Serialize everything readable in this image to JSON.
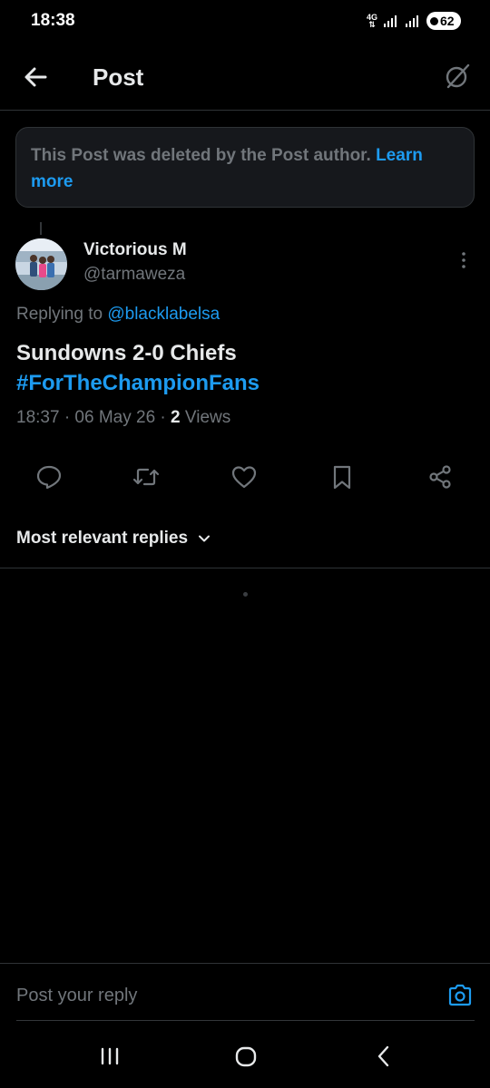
{
  "status_bar": {
    "time": "18:38",
    "network": "4G",
    "battery": "62"
  },
  "header": {
    "title": "Post",
    "back_icon": "arrow-left-icon",
    "grok_icon": "grok-icon"
  },
  "deleted_notice": {
    "text": "This Post was deleted by the Post author. ",
    "link": "Learn more"
  },
  "post": {
    "display_name": "Victorious M",
    "handle": "@tarmaweza",
    "replying_prefix": "Replying to ",
    "replying_to": "@blacklabelsa",
    "text_line1": "Sundowns 2-0 Chiefs",
    "hashtag": "#ForTheChampionFans",
    "timestamp": "18:37 · 06 May 26 · ",
    "views_count": "2",
    "views_label": " Views"
  },
  "actions": [
    "reply-icon",
    "repost-icon",
    "like-icon",
    "bookmark-icon",
    "share-icon"
  ],
  "replies": {
    "sort_label": "Most relevant replies"
  },
  "composer": {
    "placeholder": "Post your reply"
  },
  "colors": {
    "accent": "#1d9bf0",
    "background": "#000000",
    "text_primary": "#e7e9ea",
    "text_secondary": "#71767b",
    "border": "#2f3336"
  }
}
